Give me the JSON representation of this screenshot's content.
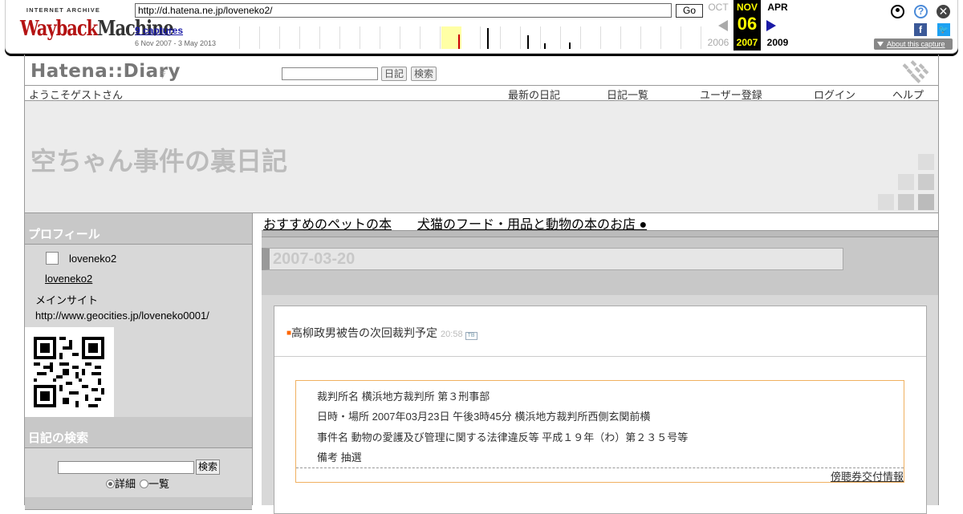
{
  "wayback": {
    "logo_top": "INTERNET ARCHIVE",
    "logo_main_a": "Wayback",
    "logo_main_b": "Machine",
    "url": "http://d.hatena.ne.jp/loveneko2/",
    "go_label": "Go",
    "captures_label": "9 captures",
    "date_range": "6 Nov 2007 - 3 May 2013",
    "prev_month": "OCT",
    "prev_year": "2006",
    "cur_month": "NOV",
    "cur_day": "06",
    "cur_year": "2007",
    "next_month": "APR",
    "next_year": "2009",
    "about_label": "About this capture",
    "icons": [
      "user-icon",
      "help-icon",
      "close-icon",
      "facebook-icon",
      "twitter-icon"
    ]
  },
  "hatena": {
    "logo": "Hatena::Diary",
    "btn_diary": "日記",
    "btn_search": "検索",
    "welcome": "ようこそゲストさん",
    "nav": [
      "最新の日記",
      "日記一覧",
      "ユーザー登録",
      "ログイン",
      "ヘルプ"
    ],
    "blog_title": "空ちゃん事件の裏日記"
  },
  "sidebar": {
    "profile_head": "プロフィール",
    "user_id": "loveneko2",
    "user_link": "loveneko2",
    "mainsite": "メインサイト http://www.geocities.jp/loveneko0001/",
    "search_head": "日記の検索",
    "search_btn": "検索",
    "radio_detail": "詳細",
    "radio_list": "一覧"
  },
  "main": {
    "link1": "おすすめのペットの本",
    "link2": "犬猫のフード・用品と動物の本のお店 ●",
    "date": "2007-03-20",
    "entry_title": "高柳政男被告の次回裁判予定",
    "entry_time": "20:58",
    "entry_tb": "TB",
    "lines": [
      "裁判所名 横浜地方裁判所 第３刑事部",
      "日時・場所 2007年03月23日 午後3時45分 横浜地方裁判所西側玄関前横",
      "事件名 動物の愛護及び管理に関する法律違反等 平成１９年（わ）第２３５号等",
      "備考 抽選"
    ],
    "tickets_link": "傍聴券交付情報"
  }
}
